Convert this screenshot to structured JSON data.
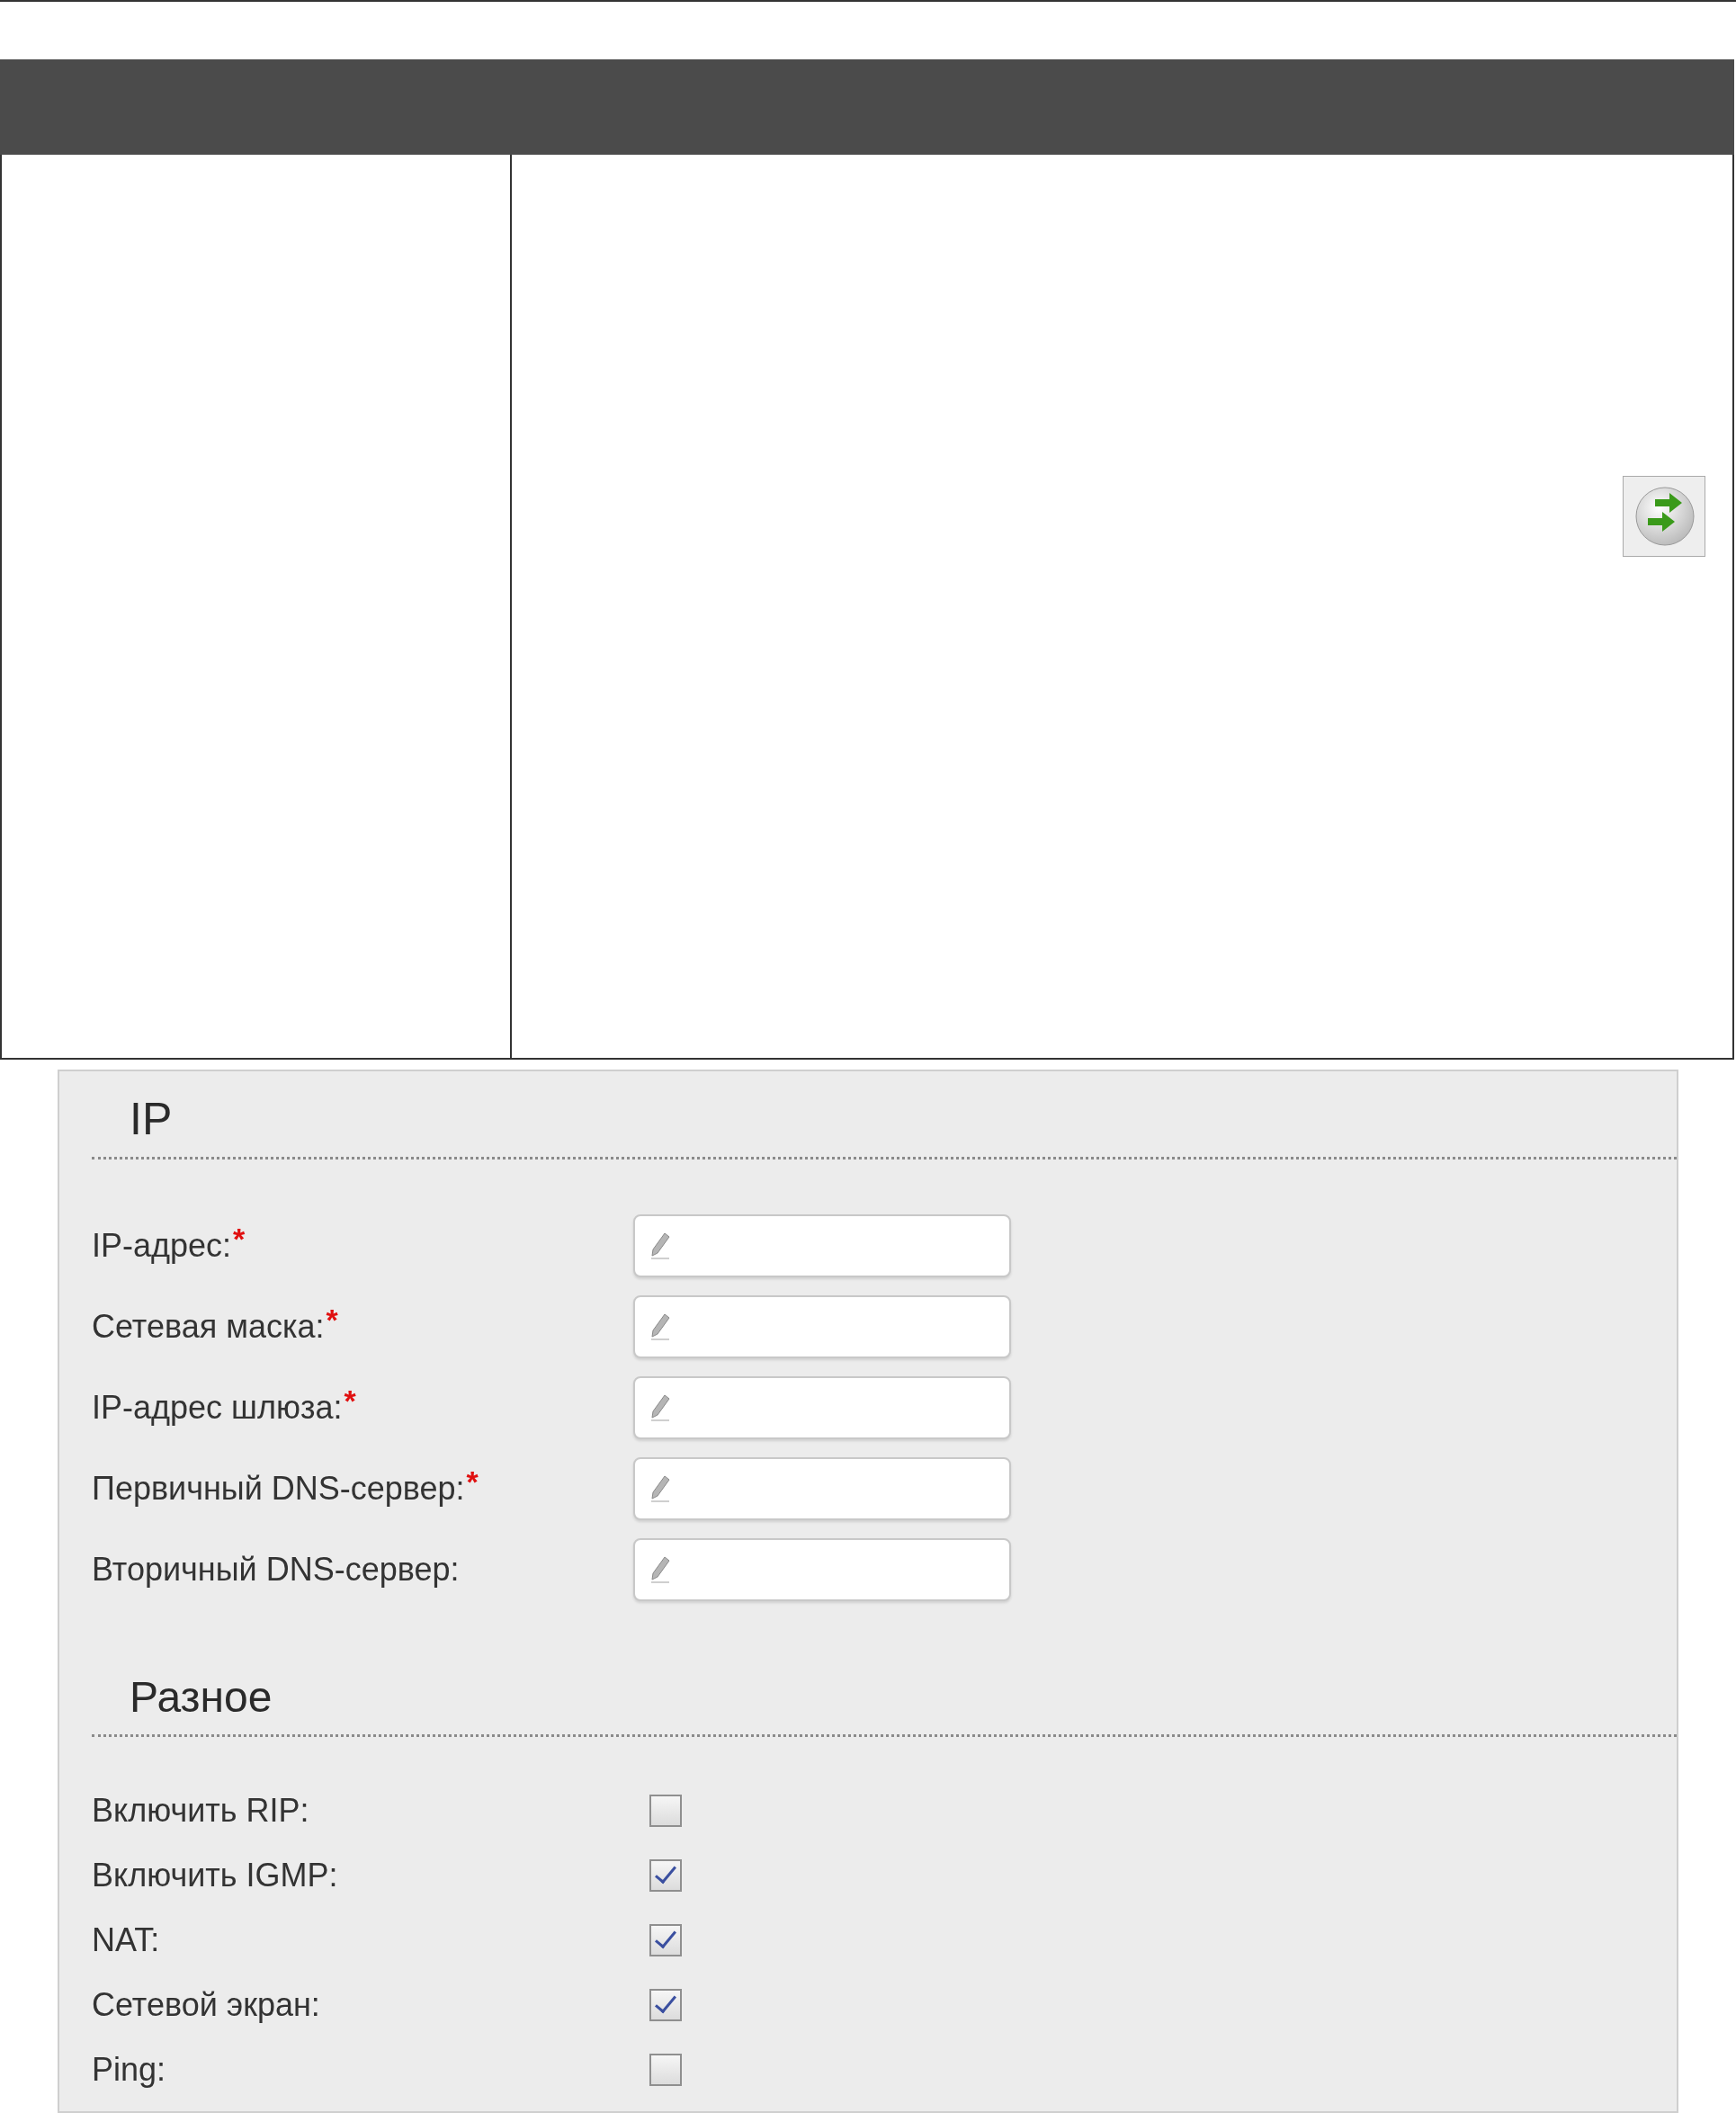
{
  "ip_section": {
    "title": "IP",
    "fields": [
      {
        "label": "IP-адрес:",
        "required_mark": "*"
      },
      {
        "label": "Сетевая маска:",
        "required_mark": "*"
      },
      {
        "label": "IP-адрес шлюза:",
        "required_mark": "*"
      },
      {
        "label": "Первичный DNS-сервер:",
        "required_mark": "*"
      },
      {
        "label": "Вторичный DNS-сервер:"
      }
    ]
  },
  "misc_section": {
    "title": "Разное",
    "options": [
      {
        "label": "Включить RIP:",
        "checked": false
      },
      {
        "label": "Включить IGMP:",
        "checked": true
      },
      {
        "label": "NAT:",
        "checked": true
      },
      {
        "label": "Сетевой экран:",
        "checked": true
      },
      {
        "label": "Ping:",
        "checked": false
      }
    ]
  }
}
